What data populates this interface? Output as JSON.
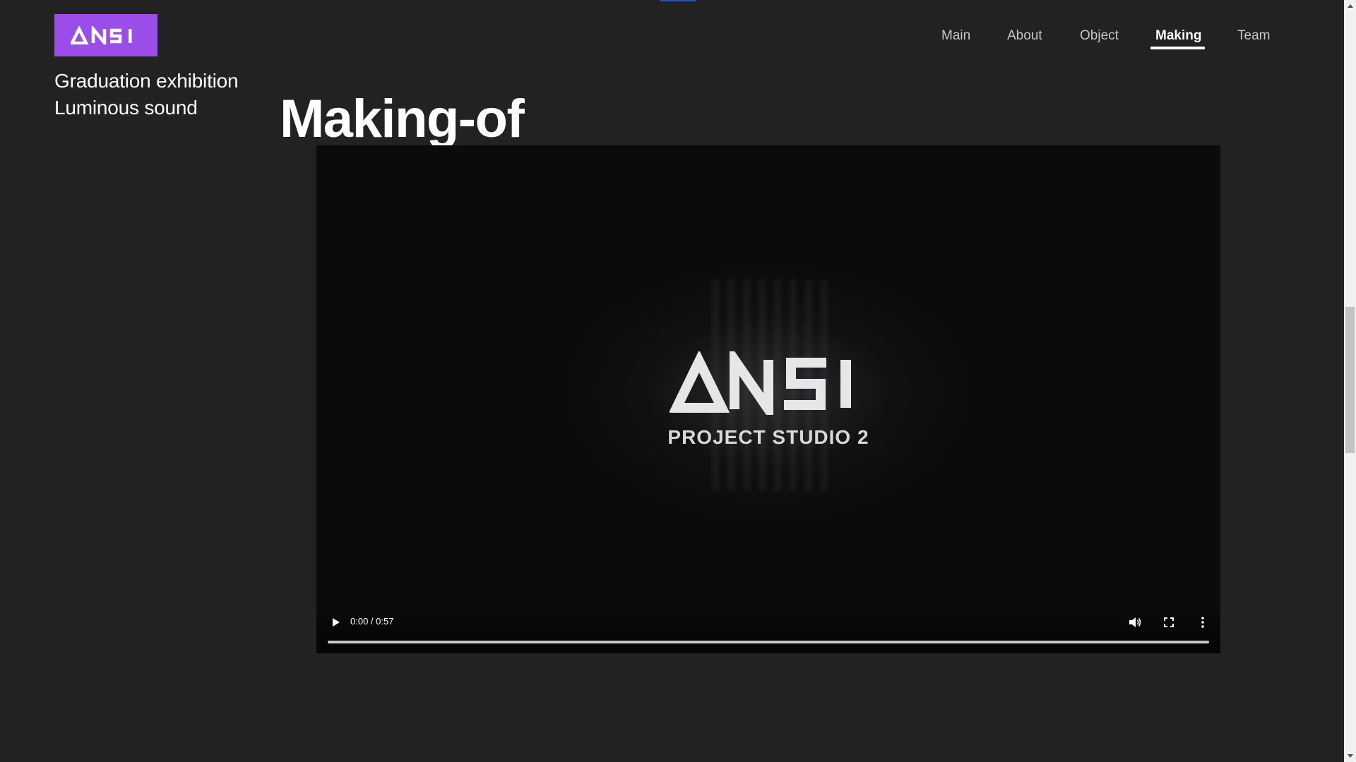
{
  "brand": {
    "logo_text": "ANSI",
    "logo_color": "#9b4dea"
  },
  "subtitle": {
    "line1": "Graduation exhibition",
    "line2": "Luminous sound"
  },
  "nav": {
    "items": [
      {
        "label": "Main"
      },
      {
        "label": "About"
      },
      {
        "label": "Object"
      },
      {
        "label": "Making"
      },
      {
        "label": "Team"
      }
    ],
    "active": "Making"
  },
  "main": {
    "heading": "Making-of"
  },
  "video": {
    "logo_text": "ANSI",
    "caption": "PROJECT STUDIO 2",
    "time_display": "0:00 / 0:57",
    "progress_fraction": 0,
    "icons": [
      "play-icon",
      "volume-icon",
      "fullscreen-icon",
      "more-options-icon"
    ]
  },
  "colors": {
    "background": "#222222",
    "accent_indicator": "#2a4fd6"
  }
}
